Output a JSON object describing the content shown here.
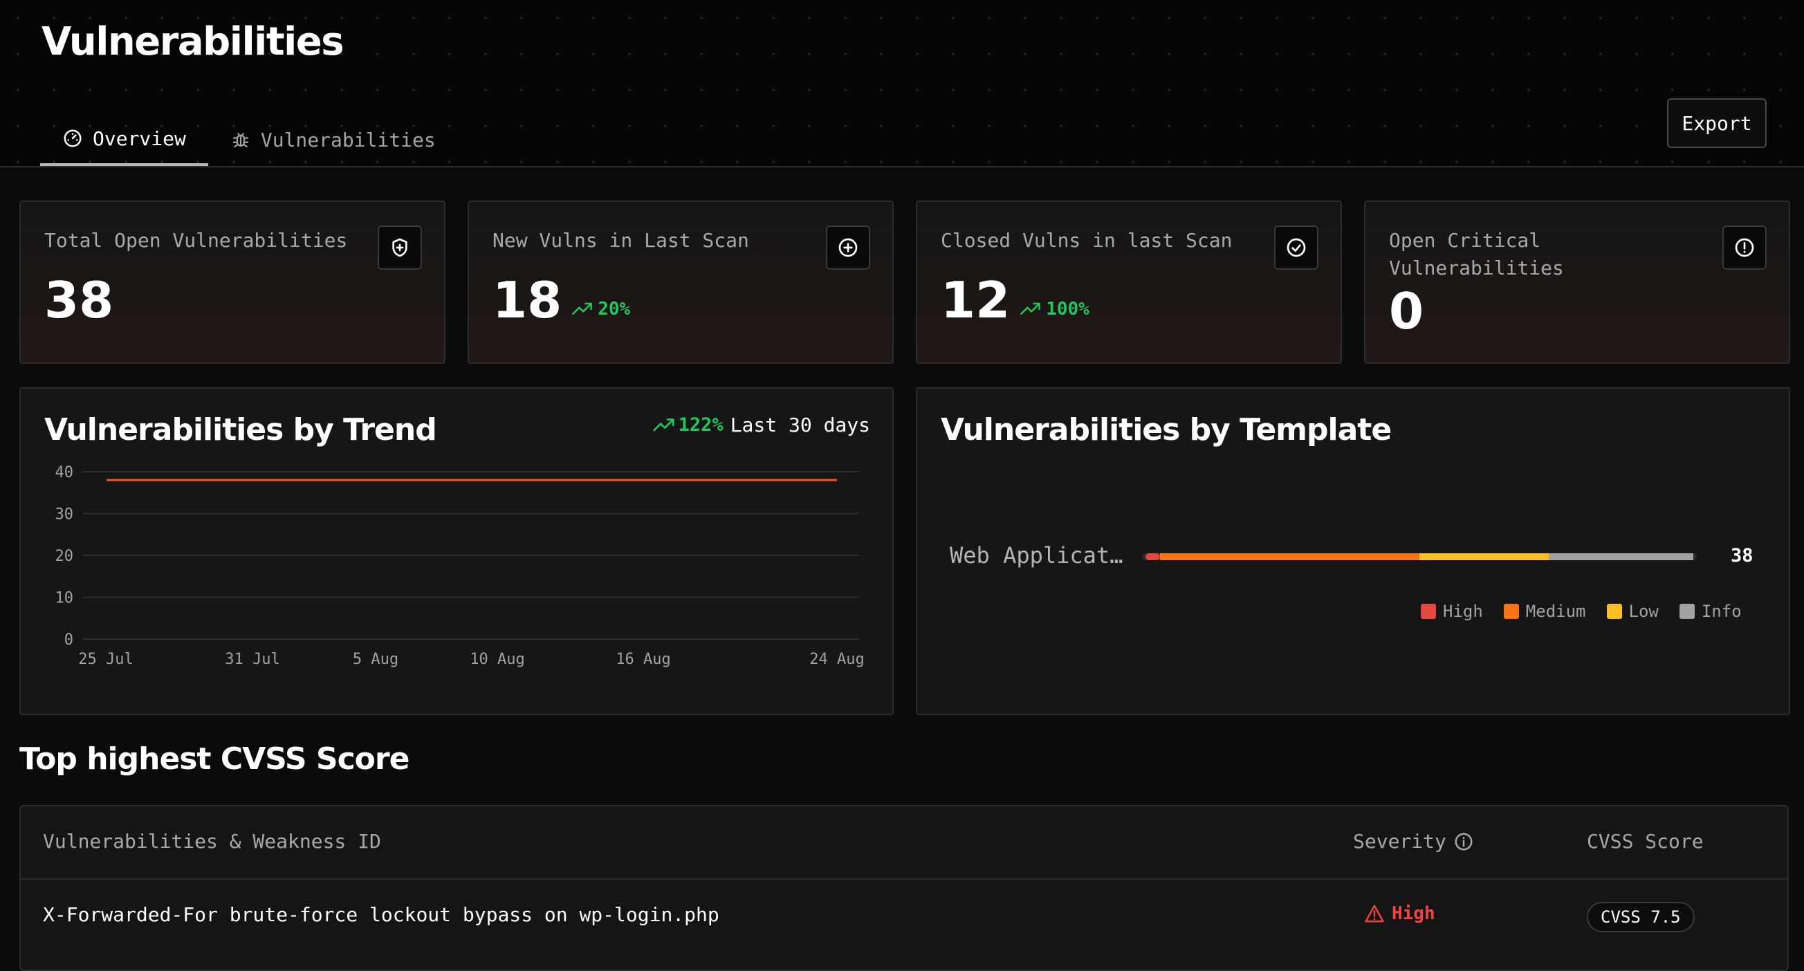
{
  "page": {
    "title": "Vulnerabilities"
  },
  "tabs": [
    {
      "label": "Overview",
      "icon": "gauge-icon",
      "active": true
    },
    {
      "label": "Vulnerabilities",
      "icon": "bug-icon",
      "active": false
    }
  ],
  "toolbar": {
    "export_label": "Export"
  },
  "stats": [
    {
      "label": "Total Open Vulnerabilities",
      "value": "38",
      "icon": "shield-plus-icon",
      "trend": ""
    },
    {
      "label": "New Vulns in Last Scan",
      "value": "18",
      "icon": "plus-circle-icon",
      "trend": "20%"
    },
    {
      "label": "Closed Vulns in last Scan",
      "value": "12",
      "icon": "check-circle-icon",
      "trend": "100%"
    },
    {
      "label": "Open Critical Vulnerabilities",
      "value": "0",
      "icon": "alert-circle-icon",
      "trend": ""
    }
  ],
  "trend_panel": {
    "title": "Vulnerabilities by Trend",
    "change": "122%",
    "range": "Last 30 days"
  },
  "template_panel": {
    "title": "Vulnerabilities by Template",
    "row_label": "Web Applicat…",
    "row_total": "38",
    "legend": [
      "High",
      "Medium",
      "Low",
      "Info"
    ]
  },
  "colors": {
    "high": "#e5483f",
    "medium": "#f97316",
    "low": "#fbbf24",
    "info": "#a3a3a3",
    "trend_line": "#f0582a",
    "positive": "#22c55e"
  },
  "chart_data": [
    {
      "type": "line",
      "title": "Vulnerabilities by Trend",
      "x": [
        "25 Jul",
        "31 Jul",
        "5 Aug",
        "10 Aug",
        "16 Aug",
        "24 Aug"
      ],
      "x_ticks": [
        "25 Jul",
        "31 Jul",
        "5 Aug",
        "10 Aug",
        "16 Aug",
        "24 Aug"
      ],
      "y_ticks": [
        "0",
        "10",
        "20",
        "30",
        "40"
      ],
      "ylim": [
        0,
        40
      ],
      "series": [
        {
          "values": [
            38,
            38,
            38,
            38,
            38,
            38
          ]
        }
      ],
      "grid": true
    },
    {
      "type": "bar",
      "title": "Vulnerabilities by Template",
      "categories": [
        "Web Applicat…"
      ],
      "series": [
        {
          "name": "High",
          "values": [
            1
          ]
        },
        {
          "name": "Medium",
          "values": [
            18
          ]
        },
        {
          "name": "Low",
          "values": [
            9
          ]
        },
        {
          "name": "Info",
          "values": [
            10
          ]
        }
      ],
      "total": 38,
      "orientation": "horizontal-stacked",
      "legend": "bottom-right"
    }
  ],
  "top_cvss": {
    "title": "Top highest CVSS Score",
    "columns": [
      "Vulnerabilities & Weakness ID",
      "Severity",
      "CVSS Score"
    ],
    "rows": [
      {
        "name": "X-Forwarded-For brute-force lockout bypass on wp-login.php",
        "severity": "High",
        "cvss": "CVSS 7.5"
      }
    ]
  }
}
